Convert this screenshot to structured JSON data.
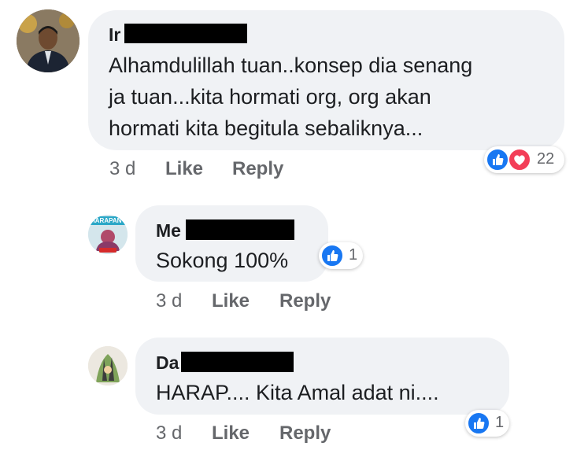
{
  "comments": [
    {
      "name": "Ir",
      "lines": [
        "Alhamdulillah tuan..konsep dia senang",
        "ja tuan...kita hormati org, org akan",
        "hormati kita begitula sebaliknya..."
      ],
      "time": "3 d",
      "like": "Like",
      "reply": "Reply",
      "reactions": "22"
    },
    {
      "name": "Me",
      "lines": [
        "Sokong 100%"
      ],
      "time": "3 d",
      "like": "Like",
      "reply": "Reply",
      "reactions": "1",
      "avatar_text": "HARAPAN"
    },
    {
      "name": "Da",
      "lines": [
        "HARAP.... Kita Amal adat ni...."
      ],
      "time": "3 d",
      "like": "Like",
      "reply": "Reply",
      "reactions": "1"
    }
  ],
  "colors": {
    "like_blue": "#1877f2",
    "love_red": "#f33e58",
    "bubble": "#f0f2f5",
    "meta": "#65676b"
  },
  "icons": {
    "like": "thumbs-up-icon",
    "love": "heart-icon"
  }
}
